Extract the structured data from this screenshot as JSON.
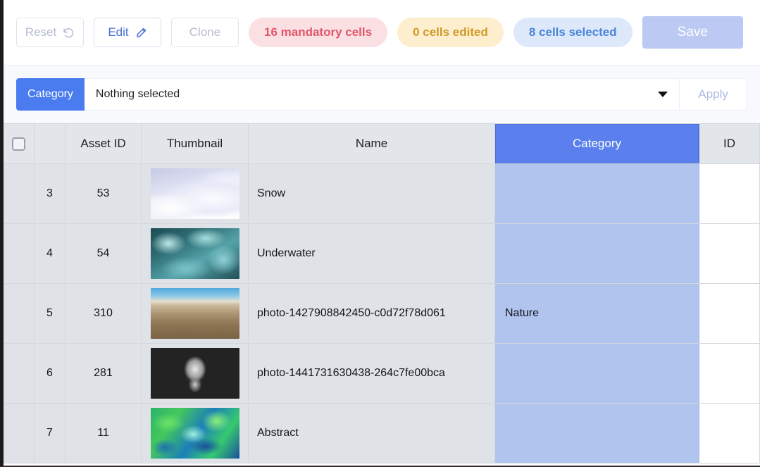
{
  "toolbar": {
    "reset_label": "Reset",
    "reset_icon": "undo-icon",
    "edit_label": "Edit",
    "edit_icon": "pencil-icon",
    "clone_label": "Clone",
    "save_label": "Save",
    "badges": {
      "mandatory": "16 mandatory cells",
      "edited": "0 cells edited",
      "selected": "8 cells selected"
    },
    "colors": {
      "mandatory_bg": "#fbe0e3",
      "mandatory_fg": "#e2566a",
      "edited_bg": "#fdeecd",
      "edited_fg": "#d09b28",
      "selected_bg": "#dde8fb",
      "selected_fg": "#4a86d8",
      "save_bg": "#bcc9f2",
      "accent": "#4a7cf0"
    }
  },
  "filter": {
    "chip_label": "Category",
    "select_value": "Nothing selected",
    "caret_icon": "chevron-down-icon",
    "apply_label": "Apply"
  },
  "grid": {
    "columns": [
      {
        "key": "check",
        "label": ""
      },
      {
        "key": "rownum",
        "label": ""
      },
      {
        "key": "asset",
        "label": "Asset ID"
      },
      {
        "key": "thumb",
        "label": "Thumbnail"
      },
      {
        "key": "name",
        "label": "Name"
      },
      {
        "key": "cat",
        "label": "Category"
      },
      {
        "key": "id",
        "label": "ID"
      }
    ],
    "select_all_icon": "checkbox-unchecked-icon",
    "highlighted_column": "Category",
    "highlight_color": "#5b80ee",
    "selection_color": "#b0c4ee",
    "rows": [
      {
        "rownum": "3",
        "asset": "53",
        "thumb": "snow-thumbnail",
        "name": "Snow",
        "category": "",
        "id": ""
      },
      {
        "rownum": "4",
        "asset": "54",
        "thumb": "underwater-thumbnail",
        "name": "Underwater",
        "category": "",
        "id": ""
      },
      {
        "rownum": "5",
        "asset": "310",
        "thumb": "desert-thumbnail",
        "name": "photo-1427908842450-c0d72f78d061",
        "category": "Nature",
        "id": ""
      },
      {
        "rownum": "6",
        "asset": "281",
        "thumb": "statue-thumbnail",
        "name": "photo-1441731630438-264c7fe00bca",
        "category": "",
        "id": ""
      },
      {
        "rownum": "7",
        "asset": "11",
        "thumb": "abstract-thumbnail",
        "name": "Abstract",
        "category": "",
        "id": ""
      }
    ]
  }
}
